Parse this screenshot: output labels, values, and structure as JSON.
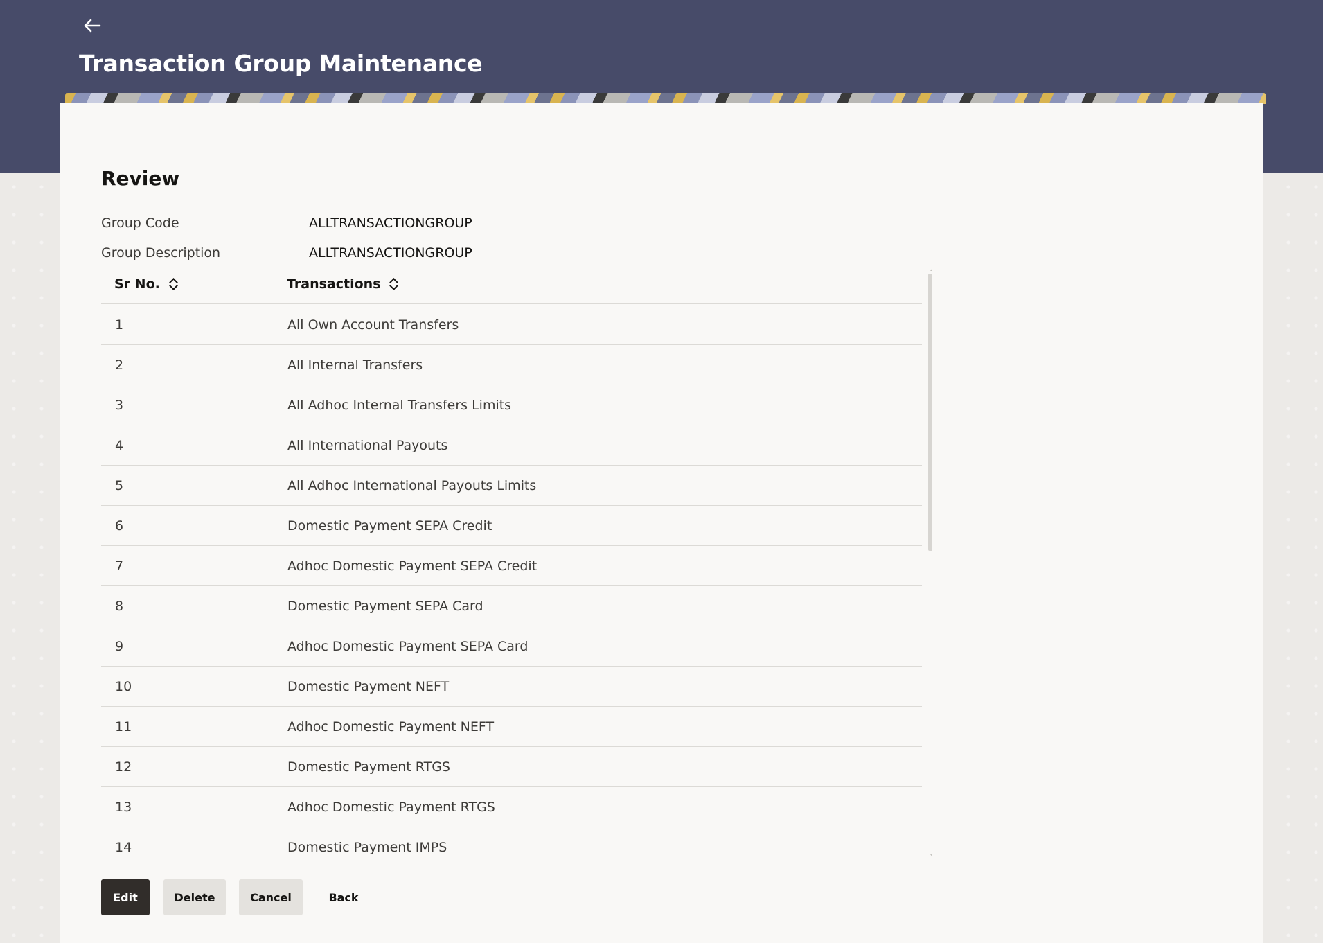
{
  "header": {
    "back_icon": "back-arrow-icon",
    "title": "Transaction Group Maintenance"
  },
  "review": {
    "section_title": "Review",
    "fields": [
      {
        "label": "Group Code",
        "value": "ALLTRANSACTIONGROUP"
      },
      {
        "label": "Group Description",
        "value": "ALLTRANSACTIONGROUP"
      }
    ]
  },
  "table": {
    "columns": [
      {
        "label": "Sr No.",
        "sort_icon": "sort-icon"
      },
      {
        "label": "Transactions",
        "sort_icon": "sort-icon"
      }
    ],
    "rows": [
      {
        "sr": "1",
        "transaction": "All Own Account Transfers"
      },
      {
        "sr": "2",
        "transaction": "All Internal Transfers"
      },
      {
        "sr": "3",
        "transaction": "All Adhoc Internal Transfers Limits"
      },
      {
        "sr": "4",
        "transaction": "All International Payouts"
      },
      {
        "sr": "5",
        "transaction": "All Adhoc International Payouts Limits"
      },
      {
        "sr": "6",
        "transaction": "Domestic Payment SEPA Credit"
      },
      {
        "sr": "7",
        "transaction": "Adhoc Domestic Payment SEPA Credit"
      },
      {
        "sr": "8",
        "transaction": "Domestic Payment SEPA Card"
      },
      {
        "sr": "9",
        "transaction": "Adhoc Domestic Payment SEPA Card"
      },
      {
        "sr": "10",
        "transaction": "Domestic Payment NEFT"
      },
      {
        "sr": "11",
        "transaction": "Adhoc Domestic Payment NEFT"
      },
      {
        "sr": "12",
        "transaction": "Domestic Payment RTGS"
      },
      {
        "sr": "13",
        "transaction": "Adhoc Domestic Payment RTGS"
      },
      {
        "sr": "14",
        "transaction": "Domestic Payment IMPS"
      }
    ]
  },
  "actions": {
    "edit": "Edit",
    "delete": "Delete",
    "cancel": "Cancel",
    "back": "Back"
  },
  "colors": {
    "header_bg": "#474b69",
    "primary_button": "#312d2a",
    "secondary_button": "#e4e2de"
  }
}
